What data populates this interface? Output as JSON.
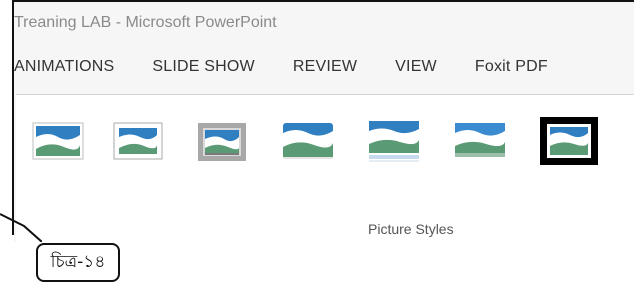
{
  "window": {
    "title": "Treaning LAB - Microsoft PowerPoint"
  },
  "tabs": [
    {
      "label": "ANIMATIONS"
    },
    {
      "label": "SLIDE SHOW"
    },
    {
      "label": "REVIEW"
    },
    {
      "label": "VIEW"
    },
    {
      "label": "Foxit PDF"
    }
  ],
  "ribbon": {
    "group_label": "Picture Styles",
    "styles": [
      {
        "icon": "picture-style-simple-frame-white-icon"
      },
      {
        "icon": "picture-style-thick-white-frame-icon"
      },
      {
        "icon": "picture-style-gray-shadow-icon"
      },
      {
        "icon": "picture-style-soft-edge-icon"
      },
      {
        "icon": "picture-style-reflected-icon"
      },
      {
        "icon": "picture-style-fade-icon"
      },
      {
        "icon": "picture-style-black-frame-icon"
      }
    ]
  },
  "callout": {
    "label": "চিত্র-১৪"
  },
  "colors": {
    "sky": "#2f7fc1",
    "hill": "#5a9a74",
    "frame_black": "#000000"
  }
}
